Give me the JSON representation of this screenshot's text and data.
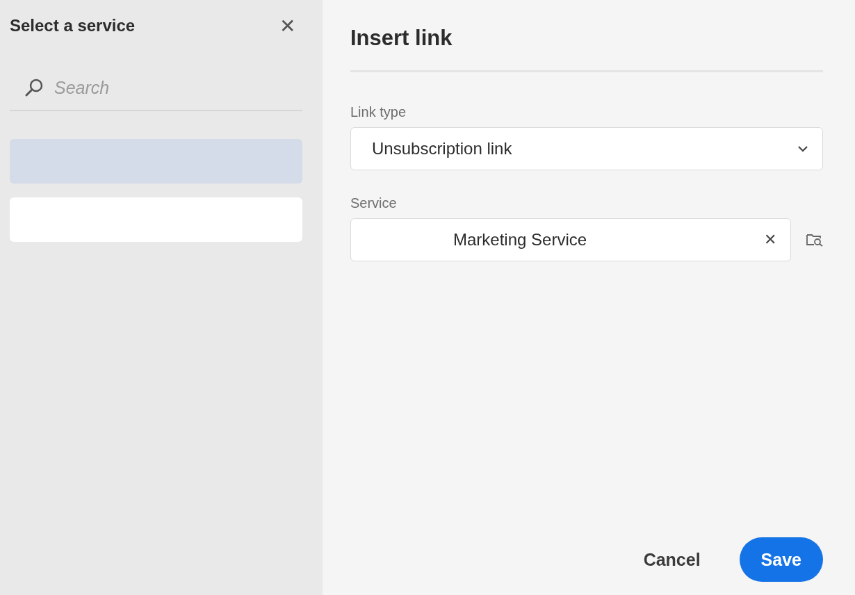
{
  "service_picker": {
    "title": "Select a service",
    "close": "✕",
    "search": {
      "placeholder": "Search"
    },
    "services": [
      {
        "selected": true
      },
      {
        "selected": false
      }
    ]
  },
  "dialog": {
    "title": "Insert link",
    "link_type": {
      "label": "Link type",
      "value": "Unsubscription link"
    },
    "service": {
      "label": "Service",
      "value": "Marketing Service",
      "clear": "✕"
    },
    "buttons": [
      {
        "kind": "secondary",
        "label": "Cancel"
      },
      {
        "kind": "primary",
        "label": "Save"
      }
    ]
  }
}
